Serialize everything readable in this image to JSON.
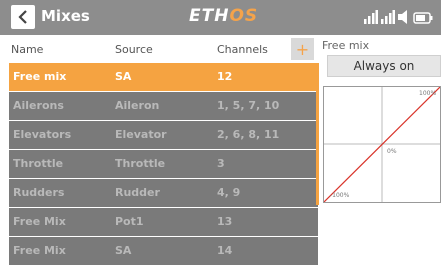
{
  "header": {
    "back_icon": "chevron-left-icon",
    "title": "Mixes",
    "logo_main": "ETH",
    "logo_accent": "OS",
    "status_icons": [
      "signal-bars-icon",
      "signal-bars-icon",
      "speaker-icon",
      "battery-icon"
    ]
  },
  "table": {
    "columns": [
      "Name",
      "Source",
      "Channels"
    ],
    "add_icon": "plus-icon",
    "rows": [
      {
        "name": "Free mix",
        "source": "SA",
        "channels": "12",
        "selected": true
      },
      {
        "name": "Ailerons",
        "source": "Aileron",
        "channels": "1, 5, 7, 10"
      },
      {
        "name": "Elevators",
        "source": "Elevator",
        "channels": "2, 6, 8, 11"
      },
      {
        "name": "Throttle",
        "source": "Throttle",
        "channels": "3"
      },
      {
        "name": "Rudders",
        "source": "Rudder",
        "channels": "4, 9"
      },
      {
        "name": "Free Mix",
        "source": "Pot1",
        "channels": "13"
      },
      {
        "name": "Free Mix",
        "source": "SA",
        "channels": "14"
      }
    ]
  },
  "panel": {
    "title": "Free mix",
    "mode": "Always on",
    "graph": {
      "label_max": "100%",
      "label_mid": "0%",
      "label_min": "-100%",
      "line_color": "#d9342b"
    }
  },
  "colors": {
    "accent": "#f5a341",
    "topbar": "#8d8d8d",
    "row_bg": "#7a7a7a"
  }
}
